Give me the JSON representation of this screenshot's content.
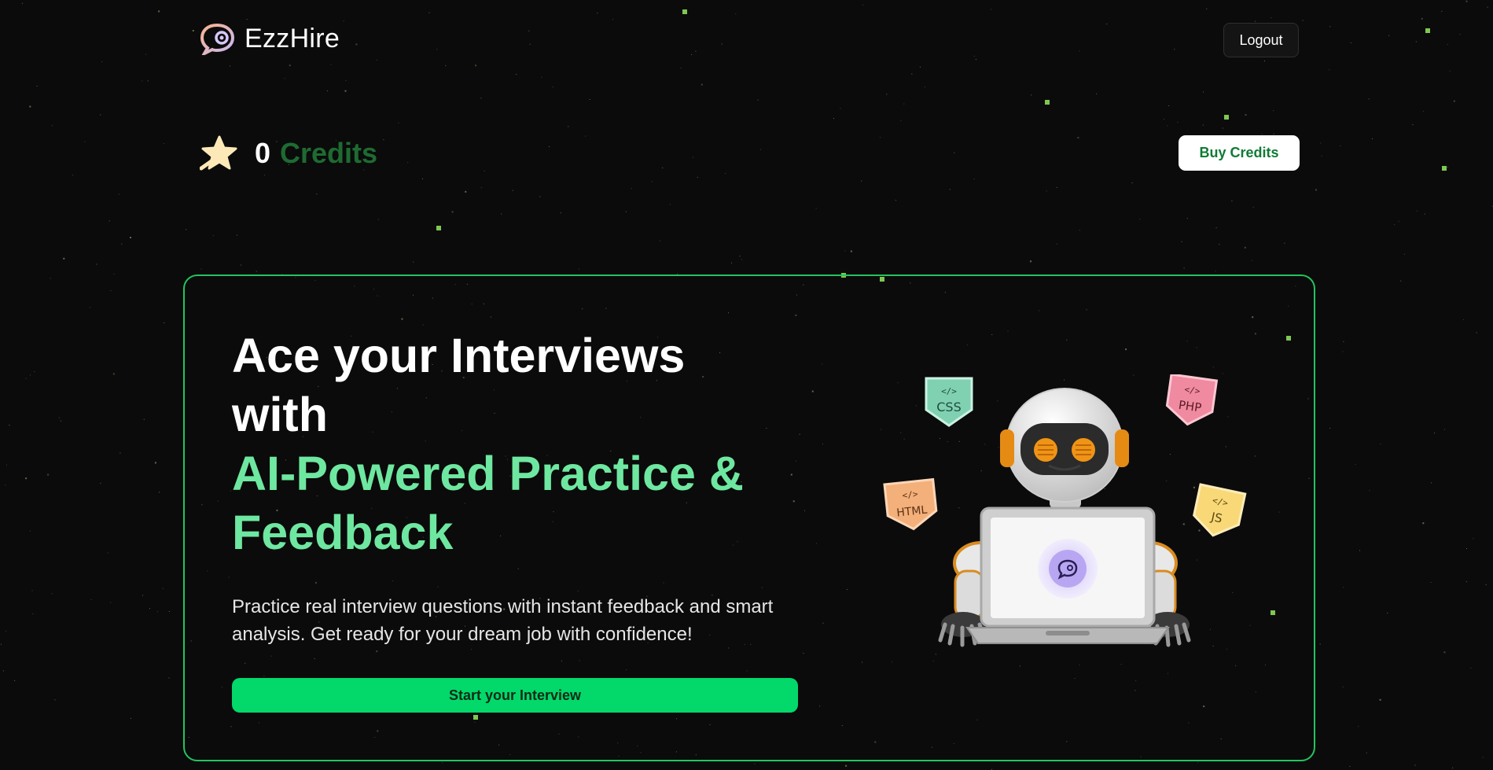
{
  "header": {
    "brand": "EzzHire",
    "logout_label": "Logout"
  },
  "credits": {
    "count": "0",
    "label": "Credits",
    "buy_label": "Buy Credits"
  },
  "hero": {
    "title_line1": "Ace your Interviews",
    "title_line2": "with",
    "title_line3": "AI-Powered Practice &",
    "title_line4": "Feedback",
    "description": "Practice real interview questions with instant feedback and smart analysis. Get ready for your dream job with confidence!",
    "cta_label": "Start your Interview"
  },
  "illustration": {
    "badges": [
      "CSS",
      "PHP",
      "HTML",
      "JS"
    ],
    "badge_code_symbol": "</>"
  },
  "colors": {
    "background": "#0b0b0b",
    "accent_green": "#22c55e",
    "title_accent": "#6ee7a0",
    "cta_green": "#02d96a",
    "credits_label_green": "#1e6b32",
    "buy_text_green": "#0f7b34"
  }
}
